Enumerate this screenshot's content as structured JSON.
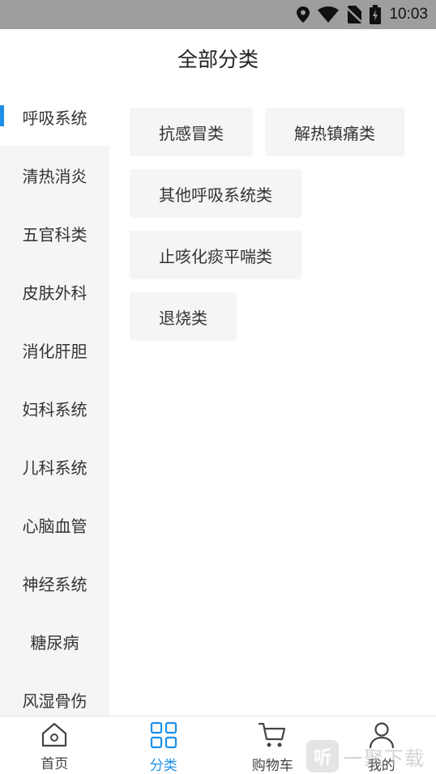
{
  "status_bar": {
    "time": "10:03"
  },
  "header": {
    "title": "全部分类"
  },
  "sidebar": {
    "items": [
      {
        "label": "呼吸系统",
        "active": true
      },
      {
        "label": "清热消炎",
        "active": false
      },
      {
        "label": "五官科类",
        "active": false
      },
      {
        "label": "皮肤外科",
        "active": false
      },
      {
        "label": "消化肝胆",
        "active": false
      },
      {
        "label": "妇科系统",
        "active": false
      },
      {
        "label": "儿科系统",
        "active": false
      },
      {
        "label": "心脑血管",
        "active": false
      },
      {
        "label": "神经系统",
        "active": false
      },
      {
        "label": "糖尿病",
        "active": false
      },
      {
        "label": "风湿骨伤",
        "active": false
      }
    ]
  },
  "subcategories": [
    "抗感冒类",
    "解热镇痛类",
    "其他呼吸系统类",
    "止咳化痰平喘类",
    "退烧类"
  ],
  "bottom_nav": {
    "items": [
      {
        "label": "首页",
        "icon": "home-icon",
        "active": false
      },
      {
        "label": "分类",
        "icon": "category-grid-icon",
        "active": true
      },
      {
        "label": "购物车",
        "icon": "cart-icon",
        "active": false
      },
      {
        "label": "我的",
        "icon": "user-icon",
        "active": false
      }
    ]
  },
  "watermark": {
    "badge": "听",
    "text": "一聚下载"
  },
  "colors": {
    "accent": "#1e90e8",
    "sidebar_bg": "#f5f5f5",
    "chip_bg": "#f5f5f5",
    "status_bar": "#9e9e9e"
  }
}
